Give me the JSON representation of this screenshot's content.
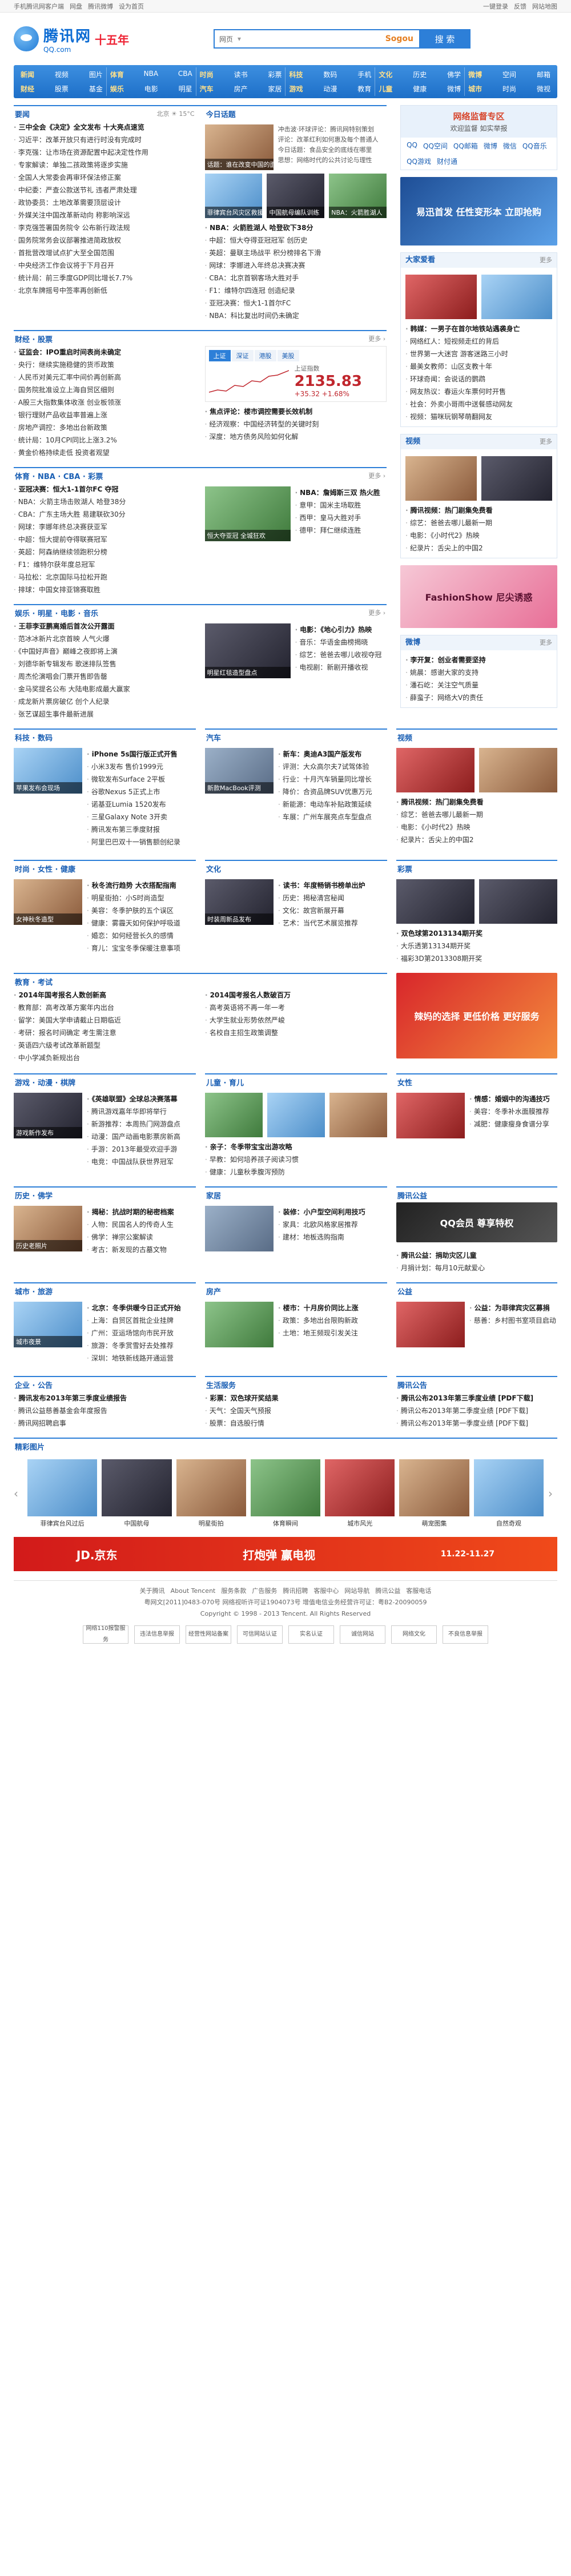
{
  "topbar": {
    "left": [
      "手机腾讯网客户端",
      "网盘",
      "腾讯微博",
      "设为首页"
    ],
    "right": [
      "一键登录",
      "反馈",
      "网站地图"
    ]
  },
  "header": {
    "logo_cn": "腾讯网",
    "logo_domain": "QQ.com",
    "logo_badge": "十五年",
    "search_type": "网页",
    "search_placeholder": "",
    "sogou": "Sogou",
    "search_button": "搜 索"
  },
  "nav": [
    {
      "rows": [
        [
          "新闻",
          "视频",
          "图片"
        ],
        [
          "财经",
          "股票",
          "基金"
        ]
      ]
    },
    {
      "rows": [
        [
          "体育",
          "NBA",
          "CBA"
        ],
        [
          "娱乐",
          "电影",
          "明星"
        ]
      ]
    },
    {
      "rows": [
        [
          "时尚",
          "读书",
          "彩票"
        ],
        [
          "汽车",
          "房产",
          "家居"
        ]
      ]
    },
    {
      "rows": [
        [
          "科技",
          "数码",
          "手机"
        ],
        [
          "游戏",
          "动漫",
          "教育"
        ]
      ]
    },
    {
      "rows": [
        [
          "文化",
          "历史",
          "佛学"
        ],
        [
          "儿童",
          "健康",
          "微博"
        ]
      ]
    },
    {
      "rows": [
        [
          "微博",
          "空间",
          "邮箱"
        ],
        [
          "城市",
          "时尚",
          "微视"
        ]
      ]
    }
  ],
  "sections": {
    "news": {
      "title": "要闻",
      "sub_title": "今日话题",
      "weather": "北京 ☀ 15°C",
      "items": [
        "三中全会《决定》全文发布 十大亮点速览",
        "习近平：改革开放只有进行时没有完成时",
        "李克强：让市场在资源配置中起决定性作用",
        "专家解读：单独二孩政策将逐步实施",
        "全国人大常委会再审环保法修正案",
        "中纪委：严查公款送节礼 违者严肃处理",
        "政协委员：土地改革需要顶层设计",
        "外媒关注中国改革新动向 称影响深远",
        "李克强签署国务院令 公布新行政法规",
        "国务院常务会议部署推进简政放权",
        "首批营改增试点扩大至全国范围",
        "中央经济工作会议将于下月召开",
        "统计局：前三季度GDP同比增长7.7%",
        "北京车牌摇号中签率再创新低"
      ],
      "topic": {
        "title": "话题：谁在改变中国的面貌？",
        "lines": [
          "冲击波·环球评论：腾讯网特别策划",
          "评论：改革红利如何惠及每个普通人",
          "今日话题：食品安全的底线在哪里",
          "思想：网络时代的公共讨论与理性"
        ]
      },
      "pics": [
        "菲律宾台风灾区救援",
        "中国航母编队训练",
        "NBA：火箭胜湖人"
      ],
      "mid_items": [
        "NBA：火箭胜湖人 哈登砍下38分",
        "中超：恒大夺得亚冠冠军 创历史",
        "英超：曼联主场战平 积分榜排名下滑",
        "网球：李娜进入年终总决赛决赛",
        "CBA：北京首钢客场大胜对手",
        "F1：维特尔四连冠 创造纪录",
        "亚冠决赛：恒大1-1首尔FC",
        "NBA：科比复出时间仍未确定"
      ]
    },
    "finance": {
      "title": "财经 · 股票",
      "items": [
        "证监会：IPO重启时间表尚未确定",
        "央行：继续实施稳健的货币政策",
        "人民币对美元汇率中间价再创新高",
        "国务院批准设立上海自贸区细则",
        "A股三大指数集体收涨 创业板领涨",
        "银行理财产品收益率普遍上涨",
        "房地产调控：多地出台新政策",
        "统计局：10月CPI同比上涨3.2%",
        "黄金价格持续走低 投资者观望"
      ],
      "stock": {
        "tabs": [
          "上证",
          "深证",
          "港股",
          "美股"
        ],
        "name": "上证指数",
        "value": "2135.83",
        "change": "+35.32  +1.68%",
        "notes": [
          "焦点评论：楼市调控需要长效机制",
          "经济观察：中国经济转型的关键时刻",
          "深度：地方债务风险如何化解"
        ]
      }
    },
    "sports": {
      "title": "体育 · NBA · CBA · 彩票",
      "items": [
        "亚冠决赛：恒大1-1首尔FC 夺冠",
        "NBA：火箭主场击败湖人 哈登38分",
        "CBA：广东主场大胜 易建联砍30分",
        "网球：李娜年终总决赛获亚军",
        "中超：恒大提前夺得联赛冠军",
        "英超：阿森纳继续领跑积分榜",
        "F1：维特尔获年度总冠军",
        "马拉松：北京国际马拉松开跑",
        "排球：中国女排亚锦赛取胜"
      ],
      "pic": "恒大夺亚冠 全城狂欢",
      "side": [
        "NBA：詹姆斯三双 热火胜",
        "意甲：国米主场取胜",
        "西甲：皇马大胜对手",
        "德甲：拜仁继续连胜"
      ]
    },
    "ent": {
      "title": "娱乐 · 明星 · 电影 · 音乐",
      "items": [
        "王菲李亚鹏离婚后首次公开露面",
        "范冰冰新片北京首映 人气火爆",
        "《中国好声音》巅峰之夜即将上演",
        "刘德华新专辑发布 歌迷排队签售",
        "周杰伦演唱会门票开售即告罄",
        "金马奖提名公布 大陆电影成最大赢家",
        "成龙新片票房破亿 创个人纪录",
        "张艺谋超生事件最新进展"
      ],
      "pic": "明星红毯造型盘点",
      "side_items": [
        "电影：《地心引力》热映",
        "音乐：华语金曲榜揭晓",
        "综艺：爸爸去哪儿收视夺冠",
        "电视剧：新剧开播收视"
      ],
      "right_title": "视频"
    },
    "tech": {
      "title": "科技 · 数码",
      "items": [
        "iPhone 5s国行版正式开售",
        "小米3发布 售价1999元",
        "微软发布Surface 2平板",
        "谷歌Nexus 5正式上市",
        "诺基亚Lumia 1520发布",
        "三星Galaxy Note 3开卖",
        "腾讯发布第三季度财报",
        "阿里巴巴双十一销售额创纪录"
      ],
      "pic": "苹果发布会现场",
      "pic2": "新款MacBook评测",
      "right_title": "汽车",
      "right_items": [
        "新车：奥迪A3国产版发布",
        "评测：大众高尔夫7试驾体验",
        "行业：十月汽车销量同比增长",
        "降价：合资品牌SUV优惠万元",
        "新能源：电动车补贴政策延续",
        "车展：广州车展亮点车型盘点"
      ]
    },
    "fashion": {
      "title": "时尚 · 女性 · 健康",
      "items": [
        "秋冬流行趋势 大衣搭配指南",
        "明星街拍：小S时尚造型",
        "美容：冬季护肤的五个误区",
        "健康：雾霾天如何保护呼吸道",
        "婚恋：如何经营长久的感情",
        "育儿：宝宝冬季保暖注意事项"
      ],
      "pic": "女神秋冬造型",
      "pic2": "时装周新品发布",
      "right_title": "文化",
      "right_items": [
        "读书：年度畅销书榜单出炉",
        "历史：揭秘清宫秘闻",
        "文化：故宫新展开幕",
        "艺术：当代艺术展览推荐"
      ]
    },
    "edu": {
      "title": "教育 · 考试",
      "items": [
        "2014年国考报名人数创新高",
        "教育部：高考改革方案年内出台",
        "留学：美国大学申请截止日期临近",
        "考研：报名时间确定 考生需注意",
        "英语四六级考试改革新题型",
        "中小学减负新规出台"
      ],
      "right_items": [
        "2014国考报名人数破百万",
        "高考英语将不再一年一考",
        "大学生就业形势依然严峻",
        "名校自主招生政策调整"
      ]
    },
    "games": {
      "title": "游戏 · 动漫 · 棋牌",
      "items": [
        "《英雄联盟》全球总决赛落幕",
        "腾讯游戏嘉年华即将举行",
        "新游推荐：本周热门网游盘点",
        "动漫：国产动画电影票房新高",
        "手游：2013年最受欢迎手游",
        "电竞：中国战队获世界冠军"
      ],
      "pic": "游戏新作发布",
      "right_title": "儿童 · 育儿",
      "right_items": [
        "亲子：冬季带宝宝出游攻略",
        "早教：如何培养孩子阅读习惯",
        "健康：儿童秋季腹泻预防"
      ],
      "far_title": "女性",
      "far_items": [
        "情感：婚姻中的沟通技巧",
        "美容：冬季补水面膜推荐",
        "减肥：健康瘦身食谱分享"
      ]
    },
    "history": {
      "title": "历史 · 佛学",
      "items": [
        "揭秘：抗战时期的秘密档案",
        "人物：民国名人的传奇人生",
        "佛学：禅宗公案解读",
        "考古：新发现的古墓文物"
      ],
      "pic": "历史老照片",
      "right_title": "家居",
      "right_items": [
        "装修：小户型空间利用技巧",
        "家具：北欧风格家居推荐",
        "建材：地板选购指南"
      ]
    },
    "city": {
      "title": "城市 · 旅游",
      "items": [
        "北京：冬季供暖今日正式开始",
        "上海：自贸区首批企业挂牌",
        "广州：亚运场馆向市民开放",
        "旅游：冬季赏雪好去处推荐",
        "深圳：地铁新线路开通运营"
      ],
      "pic": "城市夜景",
      "right_title": "房产",
      "right_items": [
        "楼市：十月房价同比上涨",
        "政策：多地出台限购新政",
        "土地：地王频现引发关注"
      ],
      "far_title": "公益",
      "far_items": [
        "公益：为菲律宾灾区募捐",
        "慈善：乡村图书室项目启动"
      ]
    },
    "misc": {
      "title": "企业 · 公告",
      "items": [
        "腾讯发布2013年第三季度业绩报告",
        "腾讯公益慈善基金会年度报告",
        "腾讯网招聘启事"
      ],
      "right_title": "生活服务",
      "right_items": [
        "彩票：双色球开奖结果",
        "天气：全国天气预报",
        "股票：自选股行情"
      ],
      "far_title": "腾讯公告",
      "far_items": [
        "腾讯公布2013年第三季度业绩 [PDF下载]",
        "腾讯公布2013年第二季度业绩 [PDF下载]",
        "腾讯公布2013年第一季度业绩 [PDF下载]"
      ]
    }
  },
  "right": {
    "login": {
      "title": "网络监督专区",
      "sub": "欢迎监督 如实举报",
      "qq": [
        "QQ",
        "QQ空间",
        "QQ邮箱",
        "微博",
        "微信",
        "QQ音乐",
        "QQ游戏",
        "财付通"
      ]
    },
    "ad1": "易迅首发 任性变形本 立即抢购",
    "recommend": {
      "title": "大家爱看",
      "items": [
        "韩媒：一男子在首尔地铁站遇袭身亡",
        "网络红人：短视频走红的背后",
        "世界第一大迷宫 游客迷路三小时",
        "最美女教师：山区支教十年",
        "环球奇闻：会说话的鹦鹉",
        "网友热议：春运火车票何时开售",
        "社会：外卖小哥雨中送餐感动网友",
        "视频：猫咪玩钢琴萌翻网友"
      ]
    },
    "video": {
      "title": "视频",
      "items": [
        "腾讯视频：热门剧集免费看",
        "综艺：爸爸去哪儿最新一期",
        "电影：《小时代2》热映",
        "纪录片：舌尖上的中国2"
      ]
    },
    "ad2": "FashionShow 尼尖诱惑",
    "blog": {
      "title": "微博",
      "items": [
        "李开复：创业者需要坚持",
        "姚晨：感谢大家的支持",
        "潘石屹：关注空气质量",
        "薛蛮子：网络大V的责任"
      ]
    },
    "ad3": "辣妈的选择 更低价格 更好服务",
    "lottery": {
      "title": "彩票",
      "items": [
        "双色球第2013134期开奖",
        "大乐透第13134期开奖",
        "福彩3D第2013308期开奖"
      ]
    },
    "ad4": "QQ会员 尊享特权",
    "notice": {
      "title": "腾讯公益",
      "items": [
        "腾讯公益：捐助灾区儿童",
        "月捐计划：每月10元献爱心"
      ]
    }
  },
  "gallery": {
    "title": "精彩图片",
    "items": [
      "菲律宾台风过后",
      "中国航母",
      "明星街拍",
      "体育瞬间",
      "城市风光",
      "萌宠图集",
      "自然奇观"
    ]
  },
  "banner_jd": {
    "brand": "JD.京东",
    "slogan": "打炮弹 赢电视",
    "date": "11.22-11.27"
  },
  "footer": {
    "links": [
      "关于腾讯",
      "About Tencent",
      "服务条款",
      "广告服务",
      "腾讯招聘",
      "客服中心",
      "网站导航",
      "腾讯公益",
      "客服电话"
    ],
    "license": "粤网文[2011]0483-070号  网络视听许可证1904073号  增值电信业务经营许可证：粤B2-20090059",
    "copyright": "Copyright © 1998 - 2013 Tencent. All Rights Reserved",
    "badges": [
      "网络110报警服务",
      "违法信息举报",
      "经营性网站备案",
      "可信网站认证",
      "实名认证",
      "诚信网站",
      "网络文化",
      "不良信息举报"
    ]
  }
}
